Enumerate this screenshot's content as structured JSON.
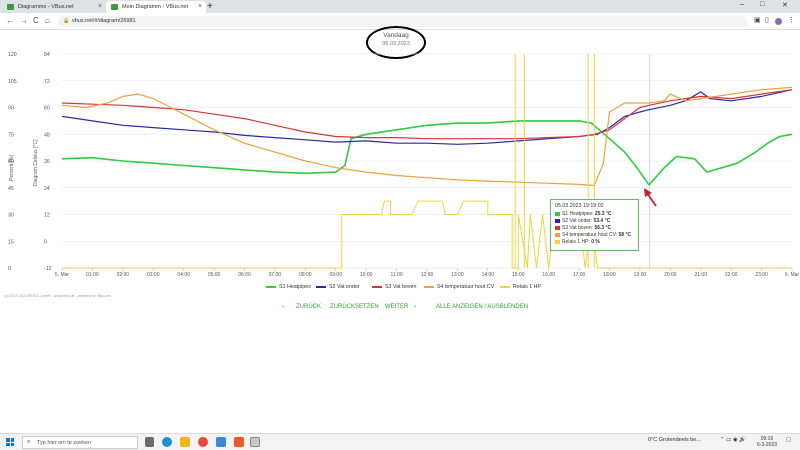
{
  "browser": {
    "tabs": [
      {
        "label": "Diagramme - VBus.net",
        "active": false
      },
      {
        "label": "Mein Diagramm - VBus.net",
        "active": true
      }
    ],
    "new_tab": "+",
    "url": "vbus.net/#/diagram/26981",
    "nav": {
      "back": "←",
      "forward": "→",
      "reload": "C",
      "home": "⌂"
    },
    "window": {
      "minimize": "–",
      "maximize": "□",
      "close": "✕"
    }
  },
  "header": {
    "title": "Vandaag",
    "date": "05.03.2023"
  },
  "chart_data": {
    "type": "line",
    "left_axes": [
      {
        "label": "Percent [%]",
        "ticks": [
          120,
          105,
          90,
          75,
          60,
          45,
          30,
          15,
          0
        ]
      },
      {
        "label": "Diagram Celsius [°C]",
        "ticks": [
          84,
          72,
          60,
          48,
          36,
          24,
          12,
          0,
          -12
        ]
      }
    ],
    "x_ticks": [
      "5. Mar",
      "01:00",
      "02:00",
      "03:00",
      "04:00",
      "05:00",
      "06:00",
      "07:00",
      "08:00",
      "09:00",
      "10:00",
      "11:00",
      "12:00",
      "13:00",
      "14:00",
      "15:00",
      "16:00",
      "17:00",
      "18:00",
      "19:00",
      "20:00",
      "21:00",
      "22:00",
      "23:00",
      "6. Mar"
    ],
    "x_range_hours": [
      0,
      24
    ],
    "y_range_celsius": [
      -12,
      84
    ],
    "grid": true,
    "crosshair_time": "19:19",
    "series": [
      {
        "name": "S1 Heatpipes",
        "color": "#2ecc40",
        "points": [
          [
            0,
            37
          ],
          [
            1,
            37.5
          ],
          [
            2,
            36
          ],
          [
            3,
            35
          ],
          [
            4,
            34
          ],
          [
            5,
            33
          ],
          [
            6,
            32
          ],
          [
            7,
            31
          ],
          [
            8,
            30.5
          ],
          [
            9,
            31
          ],
          [
            9.3,
            34
          ],
          [
            9.5,
            46
          ],
          [
            10,
            48
          ],
          [
            11,
            50
          ],
          [
            12,
            52
          ],
          [
            13,
            53
          ],
          [
            14,
            53
          ],
          [
            15,
            54
          ],
          [
            16,
            54
          ],
          [
            17,
            54
          ],
          [
            17.4,
            53
          ],
          [
            18,
            46
          ],
          [
            18.5,
            40
          ],
          [
            18.9,
            33
          ],
          [
            19.3,
            25.3
          ],
          [
            19.8,
            33
          ],
          [
            20.2,
            38
          ],
          [
            20.8,
            37
          ],
          [
            21.2,
            31
          ],
          [
            21.7,
            33
          ],
          [
            22.2,
            35
          ],
          [
            22.8,
            40
          ],
          [
            23.2,
            44
          ],
          [
            23.6,
            47
          ],
          [
            24,
            48
          ]
        ]
      },
      {
        "name": "S2 Vat onder",
        "color": "#2929a8",
        "points": [
          [
            0,
            56
          ],
          [
            1,
            54
          ],
          [
            2,
            52
          ],
          [
            3,
            51
          ],
          [
            4,
            50
          ],
          [
            5,
            49
          ],
          [
            6,
            47.5
          ],
          [
            7,
            46.5
          ],
          [
            8,
            45.5
          ],
          [
            9,
            44.5
          ],
          [
            10,
            45
          ],
          [
            11,
            44
          ],
          [
            12,
            44
          ],
          [
            13,
            43.5
          ],
          [
            14,
            44
          ],
          [
            15,
            45
          ],
          [
            16,
            46
          ],
          [
            17,
            47
          ],
          [
            17.6,
            48
          ],
          [
            18,
            51
          ],
          [
            18.5,
            56
          ],
          [
            19,
            58
          ],
          [
            19.3,
            59
          ],
          [
            20,
            61
          ],
          [
            20.5,
            63
          ],
          [
            21,
            67
          ],
          [
            21.3,
            64
          ],
          [
            22,
            63
          ],
          [
            23,
            65
          ],
          [
            24,
            68
          ]
        ]
      },
      {
        "name": "S3 Vat boven",
        "color": "#d83636",
        "points": [
          [
            0,
            62
          ],
          [
            1,
            61.5
          ],
          [
            2,
            61
          ],
          [
            3,
            60
          ],
          [
            4,
            59
          ],
          [
            5,
            57
          ],
          [
            6,
            55
          ],
          [
            7,
            52
          ],
          [
            8,
            49
          ],
          [
            9,
            47
          ],
          [
            10,
            46.5
          ],
          [
            11,
            46.5
          ],
          [
            12,
            46
          ],
          [
            13,
            46
          ],
          [
            14,
            46
          ],
          [
            15,
            46
          ],
          [
            16,
            46.5
          ],
          [
            17,
            47
          ],
          [
            17.5,
            48
          ],
          [
            18,
            50
          ],
          [
            18.5,
            55
          ],
          [
            19,
            60
          ],
          [
            19.3,
            61
          ],
          [
            20,
            63
          ],
          [
            21,
            65
          ],
          [
            22,
            64
          ],
          [
            23,
            66
          ],
          [
            24,
            68
          ]
        ]
      },
      {
        "name": "S4 temperatuur hout CV",
        "color": "#e8a33a",
        "points": [
          [
            0,
            61
          ],
          [
            0.8,
            60
          ],
          [
            1.5,
            62
          ],
          [
            2,
            65
          ],
          [
            2.5,
            66
          ],
          [
            3,
            64
          ],
          [
            4,
            57
          ],
          [
            5,
            50
          ],
          [
            6,
            44
          ],
          [
            7,
            40
          ],
          [
            8,
            36
          ],
          [
            9,
            33
          ],
          [
            10,
            31
          ],
          [
            11,
            29.5
          ],
          [
            12,
            28.5
          ],
          [
            13,
            27.5
          ],
          [
            14,
            27
          ],
          [
            15,
            26.5
          ],
          [
            16,
            26
          ],
          [
            17,
            25.5
          ],
          [
            17.5,
            25
          ],
          [
            17.8,
            35
          ],
          [
            18,
            58
          ],
          [
            18.5,
            62
          ],
          [
            19,
            62
          ],
          [
            19.3,
            62
          ],
          [
            19.8,
            63
          ],
          [
            20,
            66
          ],
          [
            20.5,
            63
          ],
          [
            21,
            64
          ],
          [
            22,
            66
          ],
          [
            23,
            68
          ],
          [
            24,
            69
          ]
        ]
      },
      {
        "name": "Relais 1 HP",
        "color": "#f2d23c",
        "segments": [
          [
            [
              0,
              -12
            ],
            [
              9.2,
              -12
            ],
            [
              9.2,
              12
            ],
            [
              10.5,
              12
            ],
            [
              10.5,
              12
            ],
            [
              10.6,
              18
            ],
            [
              10.8,
              18
            ],
            [
              10.8,
              12
            ],
            [
              11.5,
              12
            ],
            [
              11.5,
              12
            ],
            [
              11.7,
              18
            ],
            [
              12.5,
              18
            ],
            [
              12.6,
              12
            ],
            [
              13,
              12
            ],
            [
              13.2,
              18
            ],
            [
              14,
              18
            ],
            [
              14,
              12
            ],
            [
              14.8,
              12
            ],
            [
              14.8,
              -12
            ],
            [
              15,
              -12
            ],
            [
              15,
              12
            ],
            [
              15.3,
              -12
            ],
            [
              15.4,
              12
            ],
            [
              15.6,
              -12
            ],
            [
              15.8,
              12
            ],
            [
              16,
              -12
            ],
            [
              16.2,
              12
            ],
            [
              16.4,
              12
            ],
            [
              17,
              12
            ],
            [
              17.2,
              -12
            ],
            [
              17.4,
              12
            ],
            [
              17.6,
              -12
            ],
            [
              24,
              -12
            ]
          ],
          [
            [
              14.9,
              -12
            ],
            [
              14.9,
              84
            ]
          ],
          [
            [
              15.2,
              -12
            ],
            [
              15.2,
              84
            ]
          ],
          [
            [
              17.3,
              -12
            ],
            [
              17.3,
              84
            ]
          ],
          [
            [
              17.5,
              -12
            ],
            [
              17.5,
              84
            ]
          ]
        ]
      }
    ],
    "legend_position": "bottom"
  },
  "tooltip": {
    "title": "05.03.2023 19:19:02",
    "rows": [
      {
        "label": "S1 Heatpipes:",
        "value": "25.3 °C",
        "color": "#2ecc40"
      },
      {
        "label": "S2 Vat onder:",
        "value": "53.4 °C",
        "color": "#2929a8"
      },
      {
        "label": "S3 Vat boven:",
        "value": "56.3 °C",
        "color": "#d83636"
      },
      {
        "label": "S4 temperatuur hout CV:",
        "value": "58 °C",
        "color": "#e8a33a"
      },
      {
        "label": "Relais 1 HP:",
        "value": "0 %",
        "color": "#f2d23c"
      }
    ]
  },
  "copyright": "(c) 2019-2023 RESOL GmbH - www.resol.de - powered by VBus.net",
  "nav_links": {
    "prev_arrow": "‹",
    "back": "ZURÜCK",
    "reset": "ZURÜCKSETZEN",
    "next": "WEITER",
    "next_arrow": "›",
    "toggle_all": "ALLE ANZEIGEN / AUSBLENDEN"
  },
  "taskbar": {
    "search_placeholder": "Typ hier om te zoeken",
    "weather": "0°C  Grotendeels be...",
    "time": "09:16",
    "date": "6-3-2023"
  }
}
